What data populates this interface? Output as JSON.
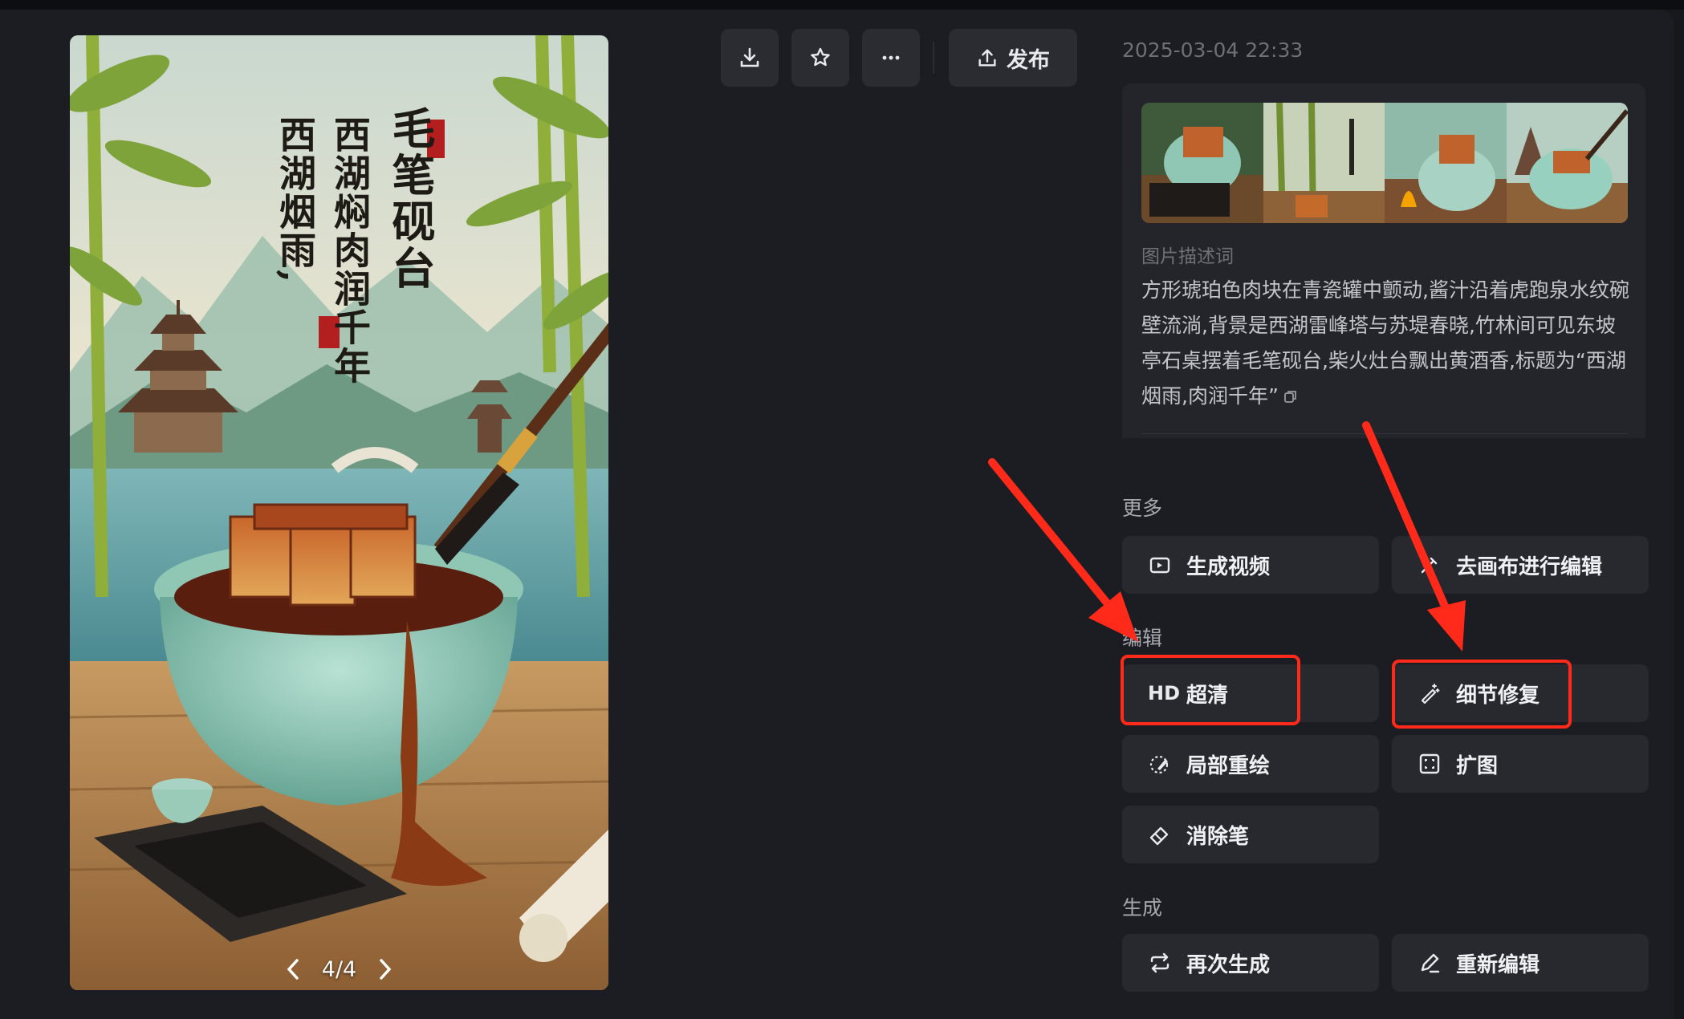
{
  "toolbar": {
    "download_icon": "download-icon",
    "favorite_icon": "star-icon",
    "more_icon": "more-icon",
    "publish_label": "发布",
    "publish_icon": "upload-icon"
  },
  "timestamp": "2025-03-04 22:33",
  "preview": {
    "page_indicator": "4/4",
    "prev_icon": "chevron-left-icon",
    "next_icon": "chevron-right-icon",
    "poster_title_1": "毛笔砚台",
    "poster_title_2": "西湖焖肉润千年",
    "poster_title_3": "西湖烟雨,"
  },
  "info": {
    "description_label": "图片描述词",
    "description_text": "方形琥珀色肉块在青瓷罐中颤动,酱汁沿着虎跑泉水纹碗壁流淌,背景是西湖雷峰塔与苏堤春晓,竹林间可见东坡亭石桌摆着毛笔砚台,柴火灶台飘出黄酒香,标题为“西湖烟雨,肉润千年”"
  },
  "sections": {
    "more": "更多",
    "edit": "编辑",
    "generate": "生成"
  },
  "actions": {
    "generate_video": "生成视频",
    "canvas_edit": "去画布进行编辑",
    "hd_prefix": "HD",
    "upscale": "超清",
    "detail_repair": "细节修复",
    "inpaint": "局部重绘",
    "outpaint": "扩图",
    "eraser": "消除笔",
    "regenerate": "再次生成",
    "re_edit": "重新编辑"
  },
  "colors": {
    "background": "#1c1d22",
    "button": "#28292e",
    "highlight": "#ff2a1a"
  }
}
